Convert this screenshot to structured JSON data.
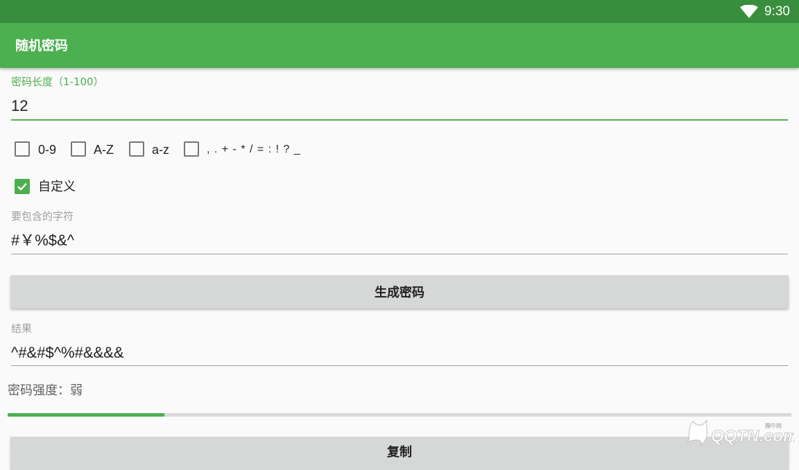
{
  "status_bar": {
    "time": "9:30",
    "wifi_icon": "wifi-icon"
  },
  "app_bar": {
    "title": "随机密码"
  },
  "length_field": {
    "label": "密码长度（1-100）",
    "value": "12"
  },
  "charset_options": [
    {
      "label": "0-9",
      "checked": false
    },
    {
      "label": "A-Z",
      "checked": false
    },
    {
      "label": "a-z",
      "checked": false
    },
    {
      "label": ", . + - * / = : ! ? _",
      "checked": false
    }
  ],
  "custom_option": {
    "label": "自定义",
    "checked": true
  },
  "include_field": {
    "label": "要包含的字符",
    "value": "#￥%$&^"
  },
  "generate_button": {
    "label": "生成密码"
  },
  "result_field": {
    "label": "结果",
    "value": "^#&#$^%#&&&&"
  },
  "strength": {
    "text": "密码强度：弱",
    "progress_fraction": 0.2
  },
  "copy_button": {
    "label": "复制"
  },
  "watermark": {
    "brand": "QQTN.com",
    "sub": "腾牛网"
  },
  "colors": {
    "primary": "#4caf50",
    "primary_dark": "#388e3c",
    "button_bg": "#d6d7d7"
  }
}
